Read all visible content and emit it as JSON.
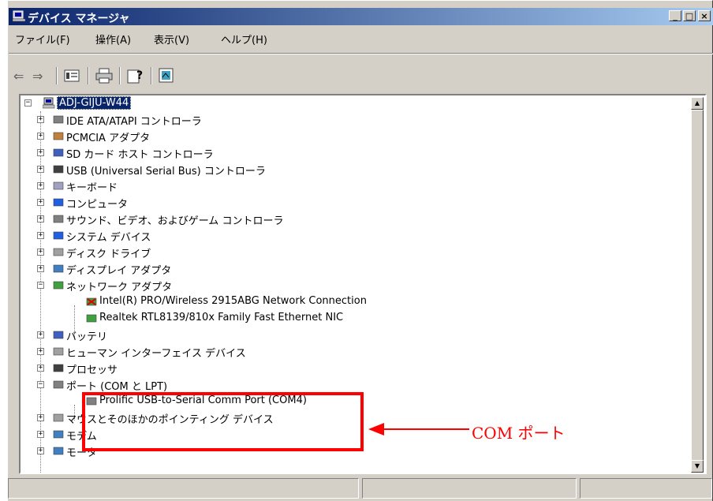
{
  "window": {
    "title": "デバイス マネージャ",
    "controls": {
      "minimize": "_",
      "maximize": "□",
      "close": "×"
    }
  },
  "menu": {
    "file": "ファイル(F)",
    "action": "操作(A)",
    "view": "表示(V)",
    "help": "ヘルプ(H)"
  },
  "toolbar": {
    "icons": [
      "back-arrow-icon",
      "forward-arrow-icon",
      "properties-icon",
      "print-icon",
      "help-icon",
      "scan-hardware-icon"
    ],
    "back": "⇐",
    "forward": "⇒"
  },
  "tree": {
    "root": "ADJ-GIJU-W44",
    "items": [
      {
        "label": "IDE ATA/ATAPI コントローラ",
        "icon": "ide-controller-icon",
        "expander": "+"
      },
      {
        "label": "PCMCIA アダプタ",
        "icon": "pcmcia-icon",
        "expander": "+"
      },
      {
        "label": "SD カード ホスト コントローラ",
        "icon": "sd-card-icon",
        "expander": "+"
      },
      {
        "label": "USB (Universal Serial Bus) コントローラ",
        "icon": "usb-icon",
        "expander": "+"
      },
      {
        "label": "キーボード",
        "icon": "keyboard-icon",
        "expander": "+"
      },
      {
        "label": "コンピュータ",
        "icon": "computer-icon",
        "expander": "+"
      },
      {
        "label": "サウンド、ビデオ、およびゲーム コントローラ",
        "icon": "sound-icon",
        "expander": "+"
      },
      {
        "label": "システム デバイス",
        "icon": "system-device-icon",
        "expander": "+"
      },
      {
        "label": "ディスク ドライブ",
        "icon": "disk-drive-icon",
        "expander": "+"
      },
      {
        "label": "ディスプレイ アダプタ",
        "icon": "display-adapter-icon",
        "expander": "+"
      },
      {
        "label": "ネットワーク アダプタ",
        "icon": "network-adapter-icon",
        "expander": "−"
      },
      {
        "label": "Intel(R) PRO/Wireless 2915ABG Network Connection",
        "icon": "network-card-disabled-icon",
        "expander": ""
      },
      {
        "label": "Realtek RTL8139/810x Family Fast Ethernet NIC",
        "icon": "network-card-icon",
        "expander": ""
      },
      {
        "label": "バッテリ",
        "icon": "battery-icon",
        "expander": "+"
      },
      {
        "label": "ヒューマン インターフェイス デバイス",
        "icon": "hid-icon",
        "expander": "+"
      },
      {
        "label": "プロセッサ",
        "icon": "processor-icon",
        "expander": "+"
      },
      {
        "label": "ポート (COM と LPT)",
        "icon": "port-icon",
        "expander": "−"
      },
      {
        "label": "Prolific USB-to-Serial Comm Port (COM4)",
        "icon": "port-device-icon",
        "expander": ""
      },
      {
        "label": "マウスとそのほかのポインティング デバイス",
        "icon": "mouse-icon",
        "expander": "+"
      },
      {
        "label": "モデム",
        "icon": "modem-icon",
        "expander": "+"
      },
      {
        "label": "モータ",
        "icon": "monitor-icon",
        "expander": "+"
      }
    ]
  },
  "annotation": {
    "label": "COM ポート",
    "color": "#ff0000"
  },
  "colors": {
    "titlebar_start": "#0a246a",
    "titlebar_end": "#a6caf0",
    "face": "#d4d0c8",
    "highlight": "#ff0000"
  }
}
